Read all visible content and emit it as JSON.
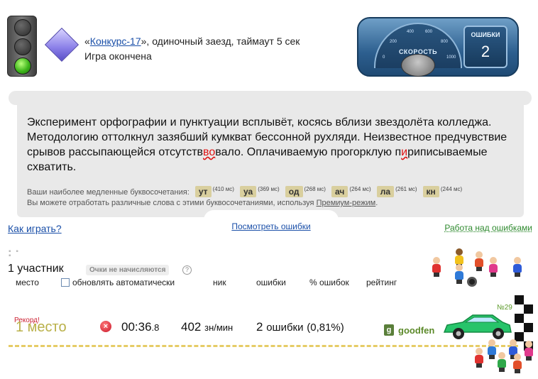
{
  "race": {
    "open_quote": "«",
    "contest_link": "Конкурс-17",
    "description": "», одиночный заезд, таймаут 5 сек",
    "status": "Игра окончена"
  },
  "dashboard": {
    "speed_label": "СКОРОСТЬ",
    "ticks": [
      "0",
      "200",
      "400",
      "600",
      "800",
      "1000"
    ],
    "errors_title": "ОШИБКИ",
    "errors_count": "2"
  },
  "passage": {
    "text_before": "Эксперимент орфографии и пунктуации всплывёт, косясь вблизи звездолёта колледжа. Методологию оттолкнул зазябший кумкват бессонной рухляди. Неизвестное предчувствие срывов рассыпающейся отсутств",
    "error_1": "во",
    "text_middle": "вало. Оплачиваемую прогорклую п",
    "error_2": "и",
    "text_after": "риписываемые схватить."
  },
  "slow_combos": {
    "label": "Ваши наиболее медленные буквосочетания:",
    "items": [
      {
        "combo": "ут",
        "ms": "(410 мс)"
      },
      {
        "combo": "уа",
        "ms": "(369 мс)"
      },
      {
        "combo": "од",
        "ms": "(268 мс)"
      },
      {
        "combo": "ач",
        "ms": "(264 мс)"
      },
      {
        "combo": "ла",
        "ms": "(261 мс)"
      },
      {
        "combo": "кн",
        "ms": "(244 мс)"
      }
    ]
  },
  "premium": {
    "text": "Вы можете отработать различные слова с этими буквосочетаниями, используя ",
    "link": "Премиум-режим",
    "end": "."
  },
  "links": {
    "show_errors": "Посмотреть ошибки",
    "how_to_play": "Как играть?",
    "work_on_errors": "Работа над ошибками"
  },
  "results": {
    "participants": "1 участник",
    "points_badge": "Очки не начисляются",
    "help_icon": "?",
    "headers": {
      "place": "место",
      "auto_update": "обновлять автоматически",
      "nick": "ник",
      "errors": "ошибки",
      "error_pct": "% ошибок",
      "rating": "рейтинг"
    },
    "row": {
      "record": "Рекорд!",
      "place": "1 место",
      "remove_icon": "×",
      "time_main": "00:36",
      "time_frac": ".8",
      "speed_value": "402",
      "speed_unit": "зн/мин",
      "errors_value": "2",
      "errors_unit": "ошибки",
      "errors_pct": "(0,81%)",
      "user_icon": "g",
      "nick": "goodfen",
      "car_number": "№29"
    }
  },
  "colors": {
    "link": "#1a4fa8",
    "nick": "#5c8a2a",
    "place": "#b9b048",
    "car": "#27c46a",
    "error_mark": "#d11"
  }
}
